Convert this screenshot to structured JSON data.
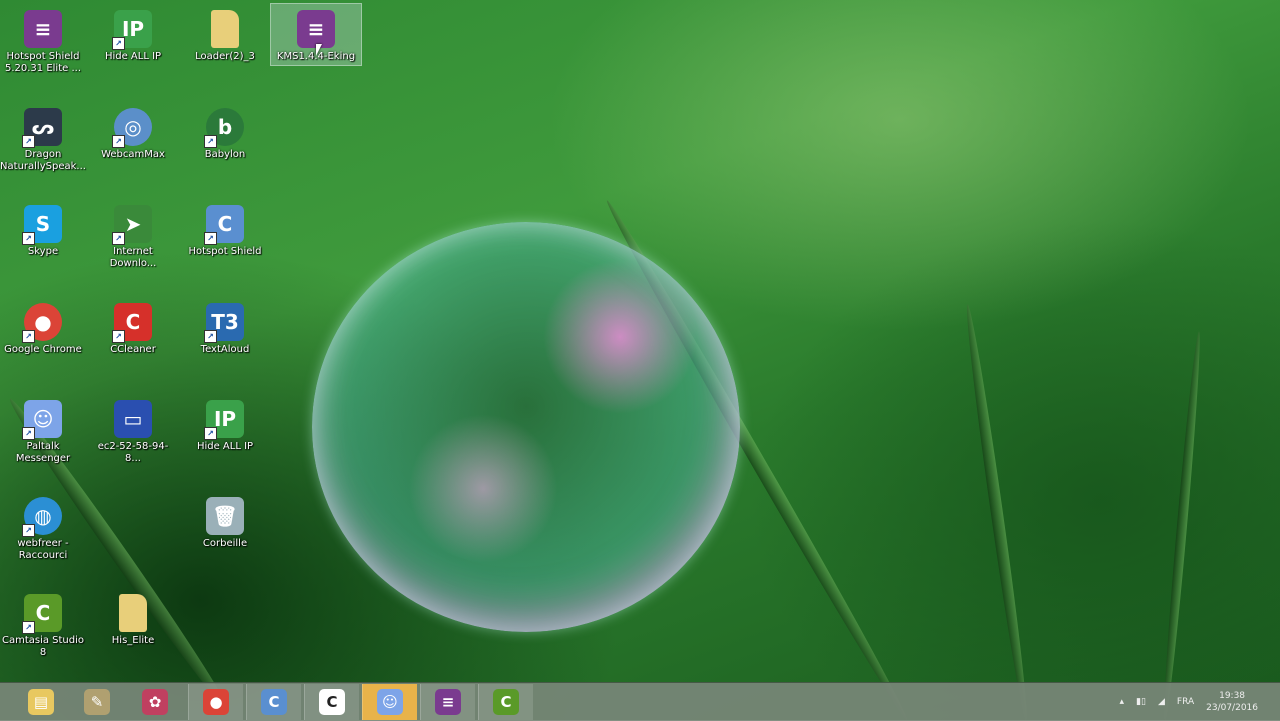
{
  "desktop": {
    "columns": [
      [
        {
          "label": "Hotspot Shield 5.20.31 Elite ...",
          "icon": "winrar-archive-icon",
          "color": "#7a3b8f",
          "glyph": "≡",
          "shortcut": false
        },
        {
          "label": "Dragon NaturallySpeak...",
          "icon": "dragon-icon",
          "color": "#2c3a4a",
          "glyph": "ᔕ",
          "shortcut": true
        },
        {
          "label": "Skype",
          "icon": "skype-icon",
          "color": "#1aa0e0",
          "glyph": "S",
          "shortcut": true
        },
        {
          "label": "Google Chrome",
          "icon": "chrome-icon",
          "color": "#db4437",
          "glyph": "●",
          "shortcut": true
        },
        {
          "label": "Paltalk Messenger",
          "icon": "paltalk-icon",
          "color": "#7da4e8",
          "glyph": "☺",
          "shortcut": true
        },
        {
          "label": "webfreer - Raccourci",
          "icon": "globe-icon",
          "color": "#2b8fd4",
          "glyph": "◍",
          "shortcut": true
        },
        {
          "label": "Camtasia Studio 8",
          "icon": "camtasia-icon",
          "color": "#5a9a28",
          "glyph": "C",
          "shortcut": true
        }
      ],
      [
        {
          "label": "Hide ALL IP",
          "icon": "shield-ip-icon",
          "color": "#3aa14a",
          "glyph": "IP",
          "shortcut": true
        },
        {
          "label": "WebcamMax",
          "icon": "webcam-icon",
          "color": "#5b8fc9",
          "glyph": "◎",
          "shortcut": true
        },
        {
          "label": "Internet Downlo...",
          "icon": "internet-download-manager-icon",
          "color": "#3a8a3a",
          "glyph": "➤",
          "shortcut": true
        },
        {
          "label": "CCleaner",
          "icon": "ccleaner-icon",
          "color": "#d6302a",
          "glyph": "C",
          "shortcut": true
        },
        {
          "label": "ec2-52-58-94-8...",
          "icon": "remote-desktop-icon",
          "color": "#2a4fb0",
          "glyph": "▭",
          "shortcut": false
        },
        null,
        {
          "label": "His_Elite",
          "icon": "folder-icon",
          "color": "#e8cf7a",
          "glyph": "",
          "shortcut": false
        }
      ],
      [
        {
          "label": "Loader(2)_3",
          "icon": "folder-icon",
          "color": "#e8cf7a",
          "glyph": "",
          "shortcut": false
        },
        {
          "label": "Babylon",
          "icon": "babylon-icon",
          "color": "#2b7a3a",
          "glyph": "b",
          "shortcut": true
        },
        {
          "label": "Hotspot Shield",
          "icon": "hotspot-shield-icon",
          "color": "#5a8fd0",
          "glyph": "C",
          "shortcut": true
        },
        {
          "label": "TextAloud",
          "icon": "textaloud-icon",
          "color": "#2a6ab0",
          "glyph": "T3",
          "shortcut": true
        },
        {
          "label": "Hide ALL IP",
          "icon": "shield-ip-icon",
          "color": "#3aa14a",
          "glyph": "IP",
          "shortcut": true
        },
        {
          "label": "Corbeille",
          "icon": "recycle-bin-icon",
          "color": "#9ab0b8",
          "glyph": "🗑",
          "shortcut": false
        }
      ],
      [
        {
          "label": "KMS1.4.4-Eking",
          "icon": "winrar-archive-icon",
          "color": "#7a3b8f",
          "glyph": "≡",
          "shortcut": false,
          "selected": true
        }
      ]
    ]
  },
  "taskbar": {
    "items": [
      {
        "name": "file-explorer",
        "icon": "file-explorer-icon",
        "color": "#e8c860",
        "glyph": "▤",
        "pinned": false
      },
      {
        "name": "tool",
        "icon": "tool-icon",
        "color": "#b0a070",
        "glyph": "✎",
        "pinned": false
      },
      {
        "name": "app",
        "icon": "app-icon",
        "color": "#c04060",
        "glyph": "✿",
        "pinned": false
      },
      {
        "name": "chrome",
        "icon": "chrome-icon",
        "color": "#db4437",
        "glyph": "●",
        "pinned": true
      },
      {
        "name": "hotspot-shield",
        "icon": "hotspot-shield-icon",
        "color": "#5a8fd0",
        "glyph": "C",
        "pinned": true
      },
      {
        "name": "camtasia-recorder",
        "icon": "camtasia-icon",
        "color": "#ffffff",
        "glyph": "C",
        "pinned": true
      },
      {
        "name": "paltalk",
        "icon": "paltalk-icon",
        "color": "#7da4e8",
        "glyph": "☺",
        "pinned": true,
        "highlight": true
      },
      {
        "name": "winrar",
        "icon": "winrar-icon",
        "color": "#7a3b8f",
        "glyph": "≡",
        "pinned": true
      },
      {
        "name": "camtasia-studio",
        "icon": "camtasia-icon",
        "color": "#5a9a28",
        "glyph": "C",
        "pinned": true
      }
    ],
    "tray": {
      "language": "FRA",
      "time": "19:38",
      "date": "23/07/2016"
    }
  }
}
